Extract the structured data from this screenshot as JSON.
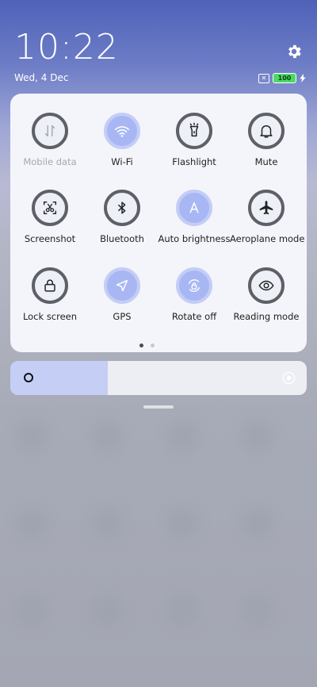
{
  "status": {
    "time": "10:22",
    "date": "Wed, 4 Dec",
    "battery": "100"
  },
  "tiles": [
    {
      "label": "Mobile data",
      "state": "disabled",
      "icon": "mobile-data-icon"
    },
    {
      "label": "Wi-Fi",
      "state": "on",
      "icon": "wifi-icon"
    },
    {
      "label": "Flashlight",
      "state": "off",
      "icon": "flashlight-icon"
    },
    {
      "label": "Mute",
      "state": "off",
      "icon": "bell-icon"
    },
    {
      "label": "Screenshot",
      "state": "off",
      "icon": "screenshot-icon"
    },
    {
      "label": "Bluetooth",
      "state": "off",
      "icon": "bluetooth-icon"
    },
    {
      "label": "Auto brightness",
      "state": "on",
      "icon": "auto-brightness-icon"
    },
    {
      "label": "Aeroplane mode",
      "state": "off",
      "icon": "airplane-icon"
    },
    {
      "label": "Lock screen",
      "state": "off",
      "icon": "lock-icon"
    },
    {
      "label": "GPS",
      "state": "on",
      "icon": "location-arrow-icon"
    },
    {
      "label": "Rotate off",
      "state": "on",
      "icon": "rotate-lock-icon"
    },
    {
      "label": "Reading mode",
      "state": "off",
      "icon": "eye-icon"
    }
  ],
  "pager": {
    "pages": 2,
    "current": 1
  },
  "brightness": {
    "level": 0.33
  },
  "colors": {
    "accent": "#a8b7f4",
    "tile_border": "#5f6067",
    "panel": "#f4f5fa",
    "battery": "#4cd964"
  }
}
